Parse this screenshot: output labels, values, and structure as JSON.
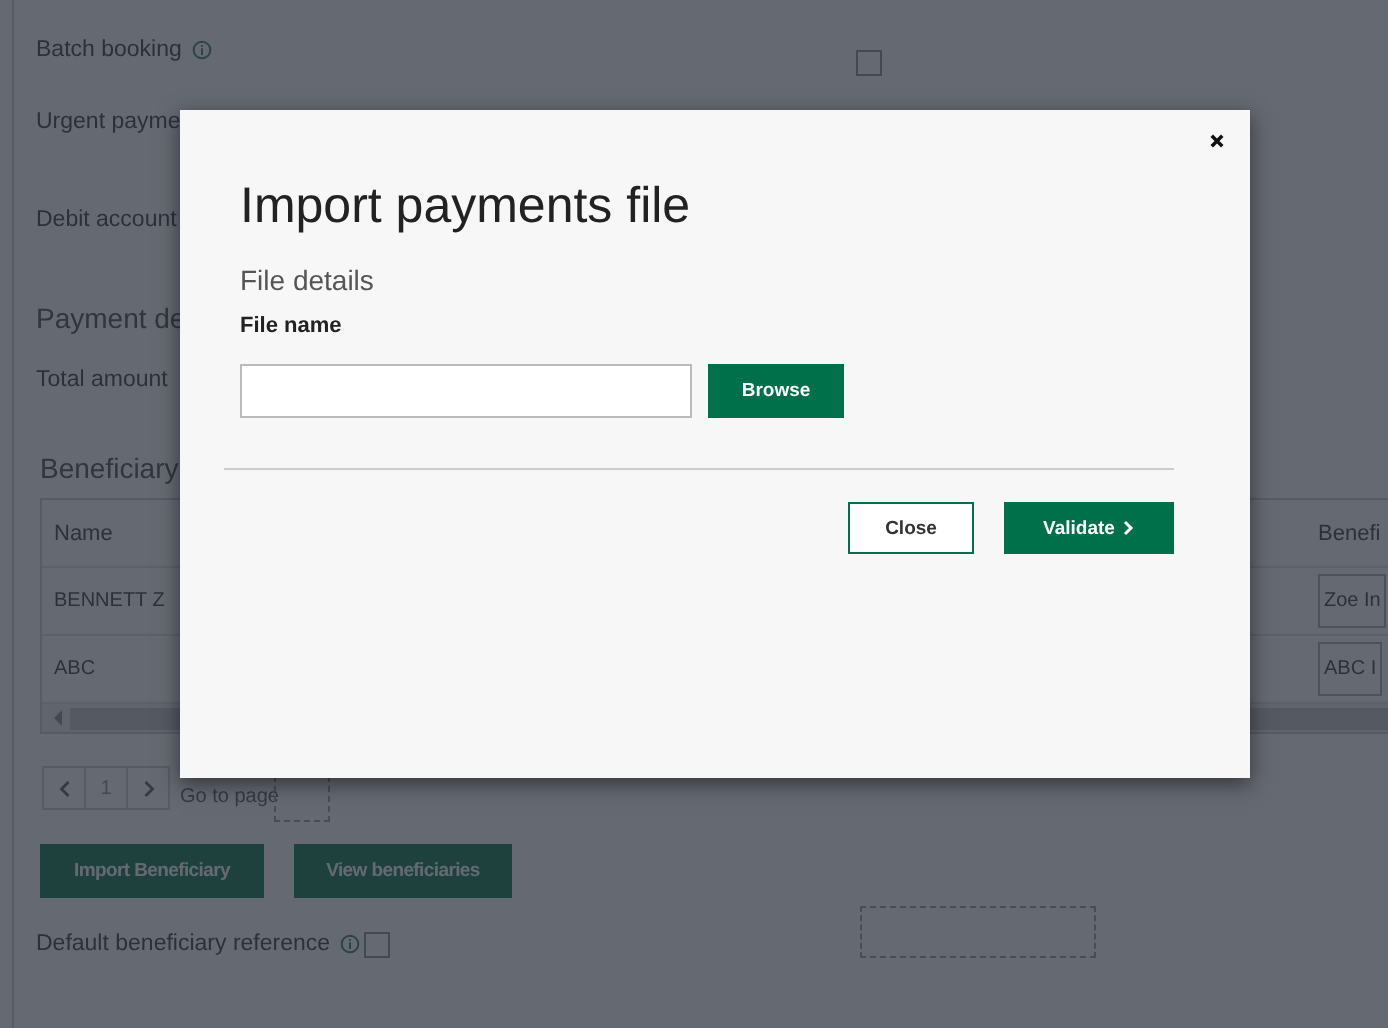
{
  "background_form": {
    "batch_booking": {
      "label": "Batch booking",
      "checked": false
    },
    "urgent_payment": {
      "label": "Urgent payme"
    },
    "debit_account": {
      "label": "Debit account"
    },
    "payment_details": {
      "heading": "Payment de"
    },
    "total_amount": {
      "label": "Total amount"
    },
    "beneficiaries": {
      "heading": "Beneficiary",
      "columns": [
        "Name",
        "Benefi"
      ],
      "rows": [
        {
          "name": "BENNETT Z",
          "column_2": "Zoe In"
        },
        {
          "name": "ABC",
          "column_2": "ABC I"
        }
      ],
      "pagination": {
        "page": "1",
        "go_to_page": "Go to page"
      },
      "buttons": [
        "Import Beneficiary",
        "View beneficiaries"
      ]
    },
    "default_reference": {
      "label": "Default beneficiary reference",
      "checked": false
    }
  },
  "dialog": {
    "title": "Import payments file",
    "section": "File details",
    "field_label": "File name",
    "browse_button": "Browse",
    "buttons": [
      {
        "label": "Close",
        "kind": "secondary"
      },
      {
        "label": "Validate",
        "kind": "primary"
      }
    ]
  }
}
